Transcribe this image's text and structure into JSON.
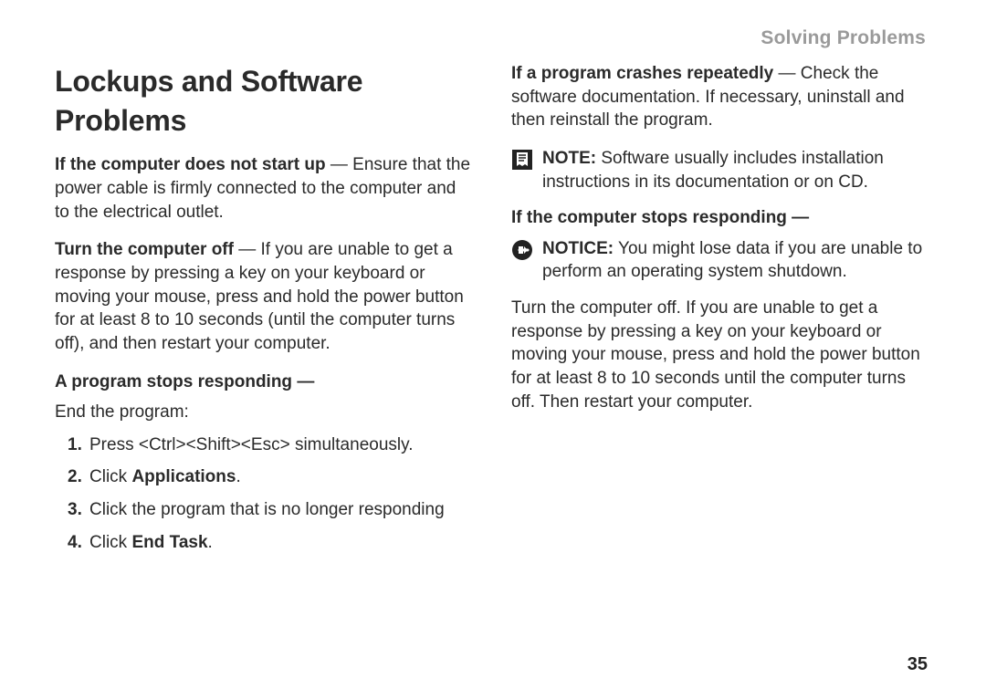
{
  "header": {
    "section_title": "Solving Problems"
  },
  "left": {
    "title": "Lockups and Software Problems",
    "p1_bold": "If the computer does not start up",
    "p1_rest": " — Ensure that the power cable is firmly connected to the computer and to the electrical outlet.",
    "p2_bold": "Turn the computer off",
    "p2_rest": " — If you are unable to get a response by pressing a key on your keyboard or moving your mouse, press and hold the power button for at least 8 to 10 seconds (until the computer turns off), and then restart your computer.",
    "p3_bold": "A program stops responding —",
    "p3_sub": "End the program:",
    "steps": {
      "s1_num": "1.",
      "s1_text": "Press <Ctrl><Shift><Esc> simultaneously.",
      "s2_num": "2.",
      "s2_pre": "Click ",
      "s2_bold": "Applications",
      "s2_post": ".",
      "s3_num": "3.",
      "s3_text": "Click the program that is no longer responding",
      "s4_num": "4.",
      "s4_pre": "Click ",
      "s4_bold": "End Task",
      "s4_post": "."
    }
  },
  "right": {
    "p1_bold": "If a program crashes repeatedly",
    "p1_rest": " — Check the software documentation. If necessary, uninstall and then reinstall the program.",
    "note_label": "NOTE:",
    "note_text": " Software usually includes installation instructions in its documentation or on CD.",
    "p2_bold": "If the computer stops responding —",
    "notice_label": "NOTICE:",
    "notice_text": " You might lose data if you are unable to perform an operating system shutdown.",
    "p3": "Turn the computer off. If you are unable to get a response by pressing a key on your keyboard or moving your mouse, press and hold the power button for at least 8 to 10 seconds until the computer turns off. Then restart your computer."
  },
  "page_number": "35"
}
